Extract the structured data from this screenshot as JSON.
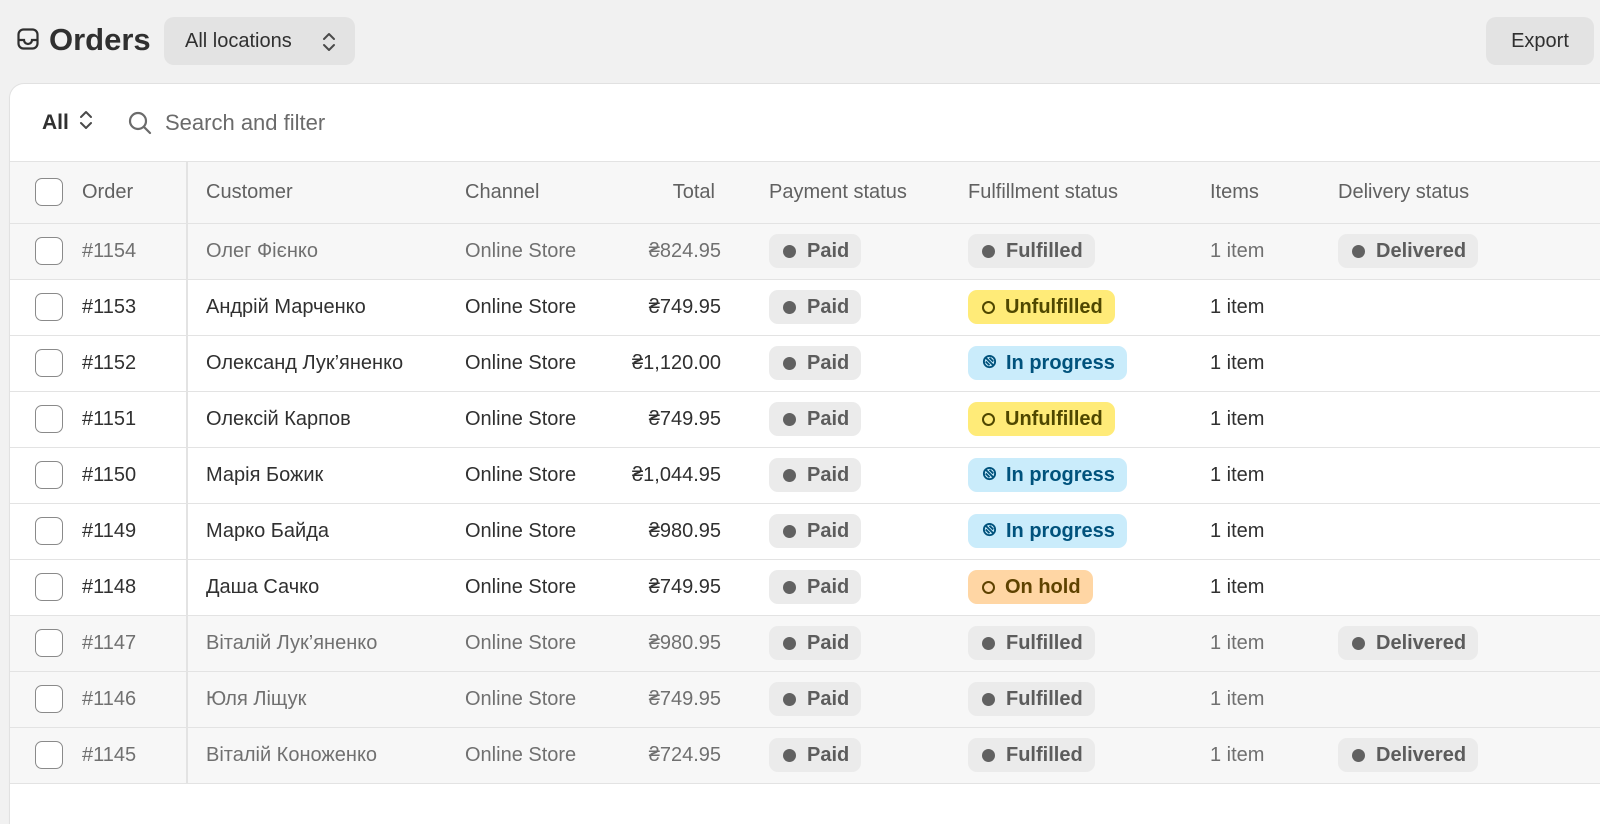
{
  "header": {
    "title": "Orders",
    "location_label": "All locations",
    "export_label": "Export"
  },
  "filter": {
    "view_label": "All",
    "search_placeholder": "Search and filter"
  },
  "columns": {
    "order": "Order",
    "customer": "Customer",
    "channel": "Channel",
    "total": "Total",
    "payment": "Payment status",
    "fulfillment": "Fulfillment status",
    "items": "Items",
    "delivery": "Delivery status"
  },
  "colors": {
    "unfulfilled": "#ffeb78",
    "in_progress": "#caecfb",
    "on_hold": "#ffd6a4",
    "neutral": "#e3e3e3"
  },
  "orders": [
    {
      "order": "#1154",
      "customer": "Олег Фієнко",
      "channel": "Online Store",
      "total": "₴824.95",
      "payment": "Paid",
      "fulfillment": "Fulfilled",
      "items": "1 item",
      "delivery": "Delivered"
    },
    {
      "order": "#1153",
      "customer": "Андрій Марченко",
      "channel": "Online Store",
      "total": "₴749.95",
      "payment": "Paid",
      "fulfillment": "Unfulfilled",
      "items": "1 item",
      "delivery": ""
    },
    {
      "order": "#1152",
      "customer": "Олександ Лук’яненко",
      "channel": "Online Store",
      "total": "₴1,120.00",
      "payment": "Paid",
      "fulfillment": "In progress",
      "items": "1 item",
      "delivery": ""
    },
    {
      "order": "#1151",
      "customer": "Олексій Карпов",
      "channel": "Online Store",
      "total": "₴749.95",
      "payment": "Paid",
      "fulfillment": "Unfulfilled",
      "items": "1 item",
      "delivery": ""
    },
    {
      "order": "#1150",
      "customer": "Марія Божик",
      "channel": "Online Store",
      "total": "₴1,044.95",
      "payment": "Paid",
      "fulfillment": "In progress",
      "items": "1 item",
      "delivery": ""
    },
    {
      "order": "#1149",
      "customer": "Марко Байда",
      "channel": "Online Store",
      "total": "₴980.95",
      "payment": "Paid",
      "fulfillment": "In progress",
      "items": "1 item",
      "delivery": ""
    },
    {
      "order": "#1148",
      "customer": "Даша Сачко",
      "channel": "Online Store",
      "total": "₴749.95",
      "payment": "Paid",
      "fulfillment": "On hold",
      "items": "1 item",
      "delivery": ""
    },
    {
      "order": "#1147",
      "customer": "Віталій Лук’яненко",
      "channel": "Online Store",
      "total": "₴980.95",
      "payment": "Paid",
      "fulfillment": "Fulfilled",
      "items": "1 item",
      "delivery": "Delivered"
    },
    {
      "order": "#1146",
      "customer": "Юля Ліщук",
      "channel": "Online Store",
      "total": "₴749.95",
      "payment": "Paid",
      "fulfillment": "Fulfilled",
      "items": "1 item",
      "delivery": ""
    },
    {
      "order": "#1145",
      "customer": "Віталій Коноженко",
      "channel": "Online Store",
      "total": "₴724.95",
      "payment": "Paid",
      "fulfillment": "Fulfilled",
      "items": "1 item",
      "delivery": "Delivered"
    }
  ]
}
